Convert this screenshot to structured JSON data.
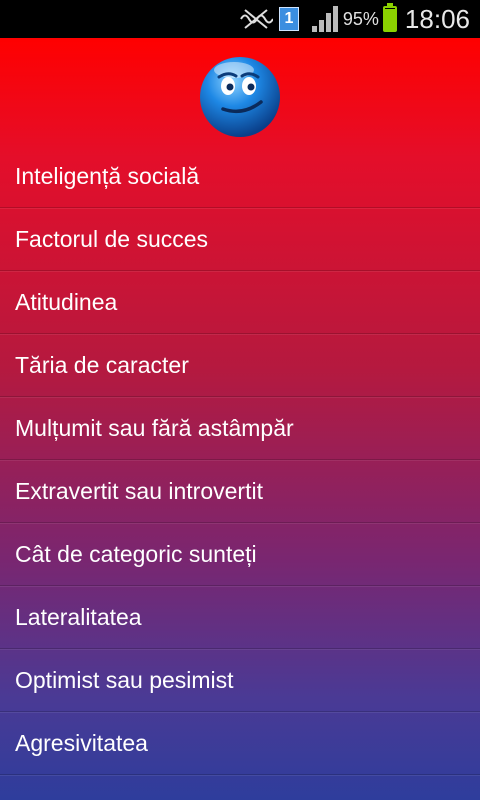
{
  "status_bar": {
    "icons": [
      "silent-mode-icon",
      "sim-one-icon",
      "signal-icon",
      "battery-icon"
    ],
    "sim_number": "1",
    "battery_percent": "95%",
    "battery_level": 0.95,
    "time": "18:06"
  },
  "header": {
    "logo": "blue-smiley-face"
  },
  "menu": {
    "items": [
      "Inteligență socială",
      "Factorul de succes",
      "Atitudinea",
      "Tăria de caracter",
      "Mulțumit sau fără astâmpăr",
      "Extravertit sau introvertit",
      "Cât de categoric sunteți",
      "Lateralitatea",
      "Optimist sau pesimist",
      "Agresivitatea"
    ]
  },
  "colors": {
    "gradient_top": "#ff0000",
    "gradient_bottom": "#2e3d9c",
    "battery": "#8bd100",
    "smiley": "#1e88e5"
  }
}
